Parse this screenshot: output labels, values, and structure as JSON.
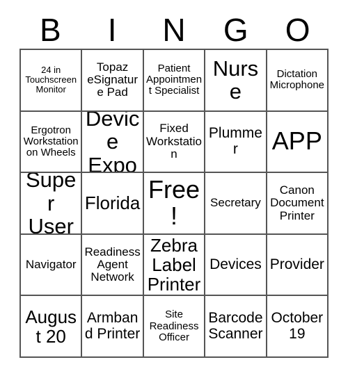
{
  "card": {
    "header_letters": [
      "B",
      "I",
      "N",
      "G",
      "O"
    ],
    "colors": {
      "text": "#000000",
      "grid_line": "#555555",
      "cell_background": "#ffffff",
      "page_background": "#ffffff"
    },
    "rows": [
      [
        {
          "label": "24 in Touchscreen Monitor",
          "size": "xs"
        },
        {
          "label": "Topaz eSignature Pad",
          "size": "md"
        },
        {
          "label": "Patient Appointment Specialist",
          "size": "sm"
        },
        {
          "label": "Nurse",
          "size": "xxl"
        },
        {
          "label": "Dictation Microphone",
          "size": "sm"
        }
      ],
      [
        {
          "label": "Ergotron Workstation on Wheels",
          "size": "sm"
        },
        {
          "label": "Device Expo",
          "size": "xxl"
        },
        {
          "label": "Fixed Workstation",
          "size": "md"
        },
        {
          "label": "Plummer",
          "size": "lg"
        },
        {
          "label": "APP",
          "size": "huge"
        }
      ],
      [
        {
          "label": "Super User",
          "size": "xxl"
        },
        {
          "label": "Florida",
          "size": "xl"
        },
        {
          "label": "Free!",
          "size": "huge"
        },
        {
          "label": "Secretary",
          "size": "md"
        },
        {
          "label": "Canon Document Printer",
          "size": "md"
        }
      ],
      [
        {
          "label": "Navigator",
          "size": "md"
        },
        {
          "label": "Readiness Agent Network",
          "size": "md"
        },
        {
          "label": "Zebra Label Printer",
          "size": "xl"
        },
        {
          "label": "Devices",
          "size": "lg"
        },
        {
          "label": "Provider",
          "size": "lg"
        }
      ],
      [
        {
          "label": "August 20",
          "size": "xl"
        },
        {
          "label": "Armband Printer",
          "size": "lg"
        },
        {
          "label": "Site Readiness Officer",
          "size": "sm"
        },
        {
          "label": "Barcode Scanner",
          "size": "lg"
        },
        {
          "label": "October 19",
          "size": "lg"
        }
      ]
    ]
  }
}
